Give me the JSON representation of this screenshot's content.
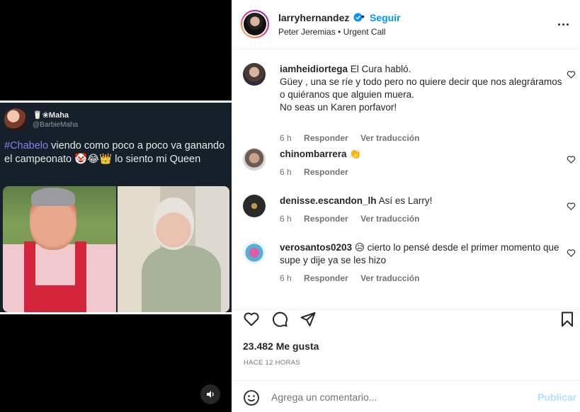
{
  "tweet": {
    "name": "🥛❀Maha",
    "handle": "@BarbieMaha",
    "hashtag": "#Chabelo",
    "text": " viendo como poco a poco va ganando el campeonato 🤡😂👑 lo siento mi Queen"
  },
  "post": {
    "username": "larryhernandez",
    "dot": "•",
    "follow_label": "Seguir",
    "audio": "Peter Jeremias • Urgent Call",
    "more_label": "..."
  },
  "comments": [
    {
      "user": "iamheidiortega",
      "text": "El Cura habló.\nGüey , una se ríe y todo pero no quiere decir que nos alegráramos o quiéranos que alguien muera.\nNo seas un Karen porfavor!",
      "time": "6 h",
      "reply": "Responder",
      "translate": "Ver traducción"
    },
    {
      "user": "chinombarrera",
      "text": "👏",
      "time": "6 h",
      "reply": "Responder",
      "translate": ""
    },
    {
      "user": "denisse.escandon_lh",
      "text": "Así es Larry!",
      "time": "6 h",
      "reply": "Responder",
      "translate": "Ver traducción"
    },
    {
      "user": "verosantos0203",
      "text": "😥 cierto lo pensé desde el primer momento que supe y dije ya se les hizo",
      "time": "6 h",
      "reply": "Responder",
      "translate": "Ver traducción"
    }
  ],
  "stats": {
    "likes": "23.482 Me gusta",
    "posted": "HACE 12 HORAS"
  },
  "add_comment": {
    "placeholder": "Agrega un comentario...",
    "publish_label": "Publicar"
  },
  "colors": {
    "accent": "#0095f6",
    "publish_disabled": "#b2dffc",
    "tweet_bg": "#15202b",
    "hashtag": "#8c7cf0"
  }
}
